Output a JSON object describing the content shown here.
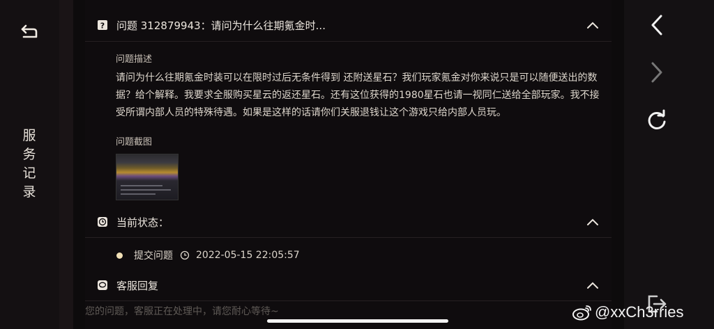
{
  "sidebar": {
    "back_icon": "back-arrow-icon",
    "tab_label": "服务记录"
  },
  "nav": {
    "prev_icon": "chevron-left-icon",
    "next_icon": "chevron-right-icon",
    "refresh_icon": "refresh-icon",
    "exit_icon": "exit-icon"
  },
  "question": {
    "header": "问题 312879943：请问为什么往期氪金时...",
    "desc_label": "问题描述",
    "description": "请问为什么往期氪金时装可以在限时过后无条件得到 还附送星石？我们玩家氪金对你来说只是可以随便送出的数据？给个解释。我要求全服购买星云的返还星石。还有这位获得的1980星石也请一视同仁送给全部玩家。我不接受所谓内部人员的特殊待遇。如果是这样的话请你们关服退钱让这个游戏只给内部人员玩。",
    "screenshot_label": "问题截图"
  },
  "status": {
    "header": "当前状态：",
    "step_label": "提交问题",
    "timestamp": "2022-05-15 22:05:57"
  },
  "reply": {
    "header": "客服回复",
    "pending_text": "您的问题，客服正在处理中，请您耐心等待~"
  },
  "watermark": "@xxCh3rries",
  "colors": {
    "background": "#0f0c0e",
    "accent_dot": "#f1e0b6",
    "text": "#ded7cd"
  }
}
